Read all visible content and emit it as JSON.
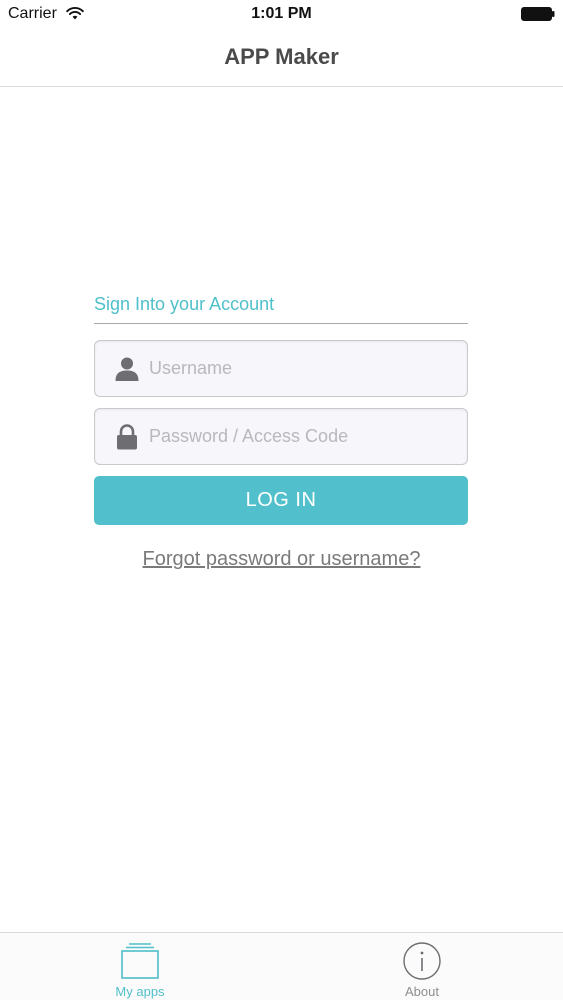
{
  "status_bar": {
    "carrier": "Carrier",
    "time": "1:01 PM",
    "icons": [
      "wifi-icon",
      "battery-icon"
    ]
  },
  "nav": {
    "title": "APP Maker"
  },
  "login": {
    "heading": "Sign Into your Account",
    "username": {
      "placeholder": "Username",
      "value": "",
      "icon": "user-icon"
    },
    "password": {
      "placeholder": "Password / Access Code",
      "value": "",
      "icon": "lock-icon"
    },
    "submit_label": "LOG IN",
    "forgot_label": "Forgot password or username?"
  },
  "tabs": [
    {
      "label": "My apps",
      "icon": "apps-stack-icon",
      "selected": true
    },
    {
      "label": "About",
      "icon": "info-icon",
      "selected": false
    }
  ],
  "colors": {
    "accent": "#52c0cc",
    "heading_text": "#4fbfc9",
    "title_text": "#4a4a4a",
    "link_text": "#7a7a7a",
    "field_bg": "#f7f6fa",
    "inactive_tab": "#8e8e93"
  }
}
